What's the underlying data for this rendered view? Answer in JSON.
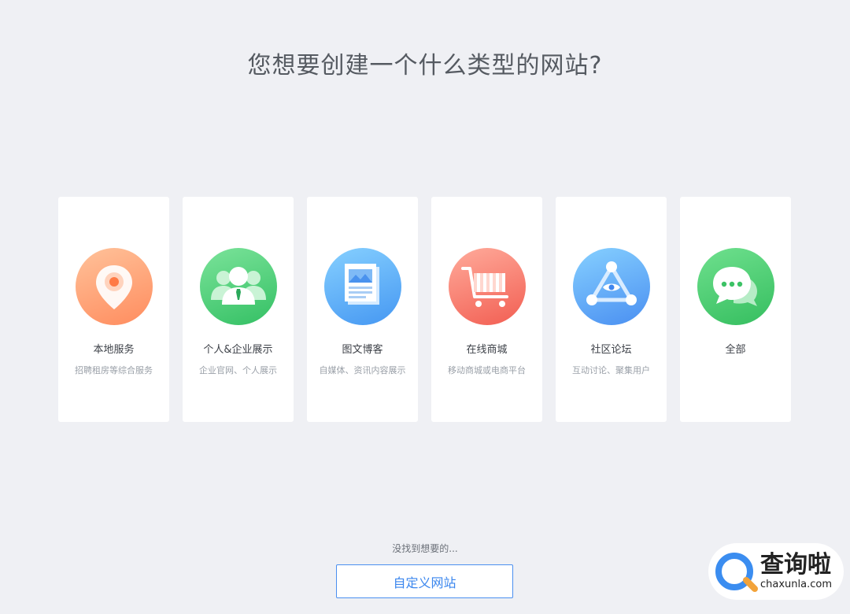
{
  "header": {
    "title": "您想要创建一个什么类型的网站?"
  },
  "categories": [
    {
      "label": "本地服务",
      "desc": "招聘租房等综合服务",
      "icon": "map-pin-icon",
      "gradient": [
        "#ffb387",
        "#ff8a5c"
      ]
    },
    {
      "label": "个人&企业展示",
      "desc": "企业官网、个人展示",
      "icon": "people-icon",
      "gradient": [
        "#6fdc8c",
        "#3ec66a"
      ]
    },
    {
      "label": "图文博客",
      "desc": "自媒体、资讯内容展示",
      "icon": "newspaper-icon",
      "gradient": [
        "#77c5fb",
        "#4a9ef5"
      ]
    },
    {
      "label": "在线商城",
      "desc": "移动商城或电商平台",
      "icon": "shopping-cart-icon",
      "gradient": [
        "#ff9a8c",
        "#f7665b"
      ]
    },
    {
      "label": "社区论坛",
      "desc": "互动讨论、聚集用户",
      "icon": "community-triangle-icon",
      "gradient": [
        "#7ac4fb",
        "#4c95f5"
      ]
    },
    {
      "label": "全部",
      "desc": "",
      "icon": "chat-bubbles-icon",
      "gradient": [
        "#62d884",
        "#39c262"
      ]
    }
  ],
  "footer": {
    "not_found_text": "没找到想要的...",
    "custom_button_label": "自定义网站"
  },
  "watermark": {
    "cn": "查询啦",
    "en": "chaxunla.com"
  },
  "colors": {
    "background": "#eff0f4",
    "accent": "#3a86ee"
  }
}
